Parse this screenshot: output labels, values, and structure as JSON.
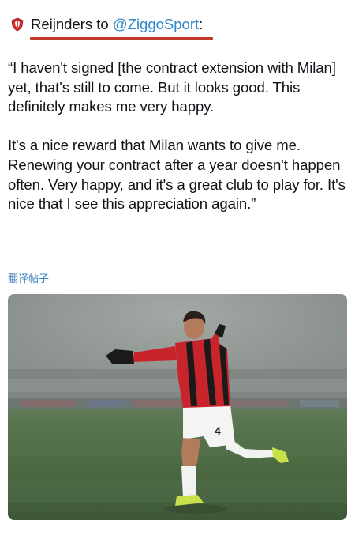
{
  "post": {
    "author": "Reijnders to ",
    "mention": "@ZiggoSport",
    "colon": ":",
    "paragraphs": [
      "“I haven't signed [the contract extension with Milan] yet, that's still to come. But it looks good. This definitely makes me very happy.",
      "It's a nice reward that Milan wants to give me. Renewing your contract after a year doesn't happen often. Very happy, and it's a great club to play for. It's nice that I see this appreciation again.”"
    ],
    "translate_label": "翻译帖子",
    "jersey_number": "4"
  },
  "colors": {
    "accent_red": "#c0392b",
    "mention_blue": "#2f86c8",
    "translate_blue": "#3b7fbe"
  },
  "icons": {
    "badge": "club-crest-icon"
  }
}
